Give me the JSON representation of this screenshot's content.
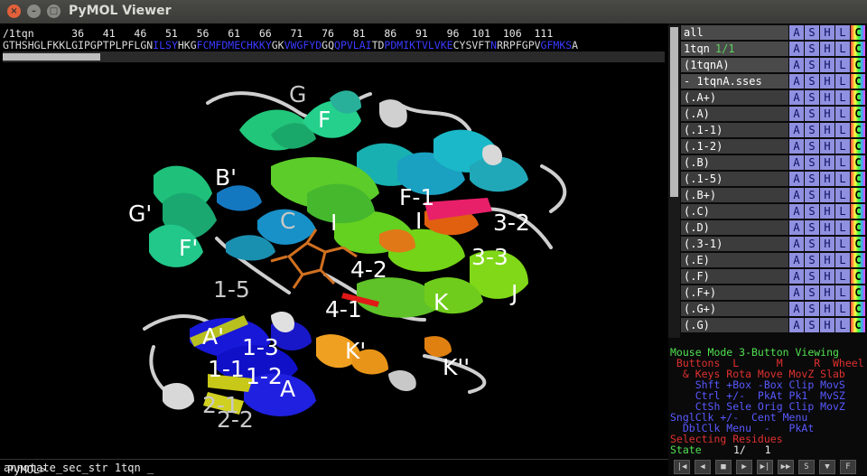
{
  "window": {
    "title": "PyMOL Viewer"
  },
  "sequence": {
    "ruler": "/1tqn      36   41   46   51   56   61   66   71   76   81   86   91   96  101  106  111",
    "residues": [
      {
        "text": "GTHSHGLFKKLGIPGPTPLPFLGN",
        "color": "#d8d8d8"
      },
      {
        "text": "ILSY",
        "color": "#3a3aff"
      },
      {
        "text": "HKG",
        "color": "#d8d8d8"
      },
      {
        "text": "FCMFDMECHKKY",
        "color": "#3a3aff"
      },
      {
        "text": "GK",
        "color": "#d8d8d8"
      },
      {
        "text": "VWGFYD",
        "color": "#3a3aff"
      },
      {
        "text": "GQ",
        "color": "#d8d8d8"
      },
      {
        "text": "QPVLAI",
        "color": "#3a3aff"
      },
      {
        "text": "TD",
        "color": "#d8d8d8"
      },
      {
        "text": "PDMIKTVLVKE",
        "color": "#3a3aff"
      },
      {
        "text": "CYSVFT",
        "color": "#d8d8d8"
      },
      {
        "text": "N",
        "color": "#3a3aff"
      },
      {
        "text": "RRPFGPV",
        "color": "#d8d8d8"
      },
      {
        "text": "GFMKS",
        "color": "#3a3aff"
      },
      {
        "text": "A",
        "color": "#d8d8d8"
      }
    ]
  },
  "viewer": {
    "labels": [
      {
        "text": "G",
        "grey": true
      },
      {
        "text": "F",
        "grey": false
      },
      {
        "text": "B'",
        "grey": false
      },
      {
        "text": "G'",
        "grey": false
      },
      {
        "text": "F-1",
        "grey": false
      },
      {
        "text": "C",
        "grey": true
      },
      {
        "text": "I",
        "grey": false
      },
      {
        "text": "I",
        "grey": false
      },
      {
        "text": "3-2",
        "grey": false
      },
      {
        "text": "3-3",
        "grey": false
      },
      {
        "text": "F'",
        "grey": false
      },
      {
        "text": "4-2",
        "grey": false
      },
      {
        "text": "1-5",
        "grey": true
      },
      {
        "text": "J",
        "grey": false
      },
      {
        "text": "4-1",
        "grey": false
      },
      {
        "text": "K",
        "grey": false
      },
      {
        "text": "A'",
        "grey": false
      },
      {
        "text": "1-3",
        "grey": false
      },
      {
        "text": "K'",
        "grey": false
      },
      {
        "text": "K''",
        "grey": false
      },
      {
        "text": "1-1",
        "grey": false
      },
      {
        "text": "1-2",
        "grey": false
      },
      {
        "text": "A",
        "grey": false
      },
      {
        "text": "2-1",
        "grey": true
      },
      {
        "text": "2-2",
        "grey": true
      }
    ]
  },
  "command": {
    "prompt": "PyMOL>",
    "text": "annotate_sec_str 1tqn _"
  },
  "objects": [
    {
      "name": "all",
      "suffix": "",
      "sub": false
    },
    {
      "name": "1tqn",
      "suffix": "1/1",
      "sub": false
    },
    {
      "name": "(1tqnA)",
      "suffix": "",
      "sub": false
    },
    {
      "name": "- 1tqnA.sses",
      "suffix": "",
      "sub": false
    },
    {
      "name": "(.A+)",
      "suffix": "",
      "sub": true
    },
    {
      "name": "(.A)",
      "suffix": "",
      "sub": true
    },
    {
      "name": "(.1-1)",
      "suffix": "",
      "sub": true
    },
    {
      "name": "(.1-2)",
      "suffix": "",
      "sub": true
    },
    {
      "name": "(.B)",
      "suffix": "",
      "sub": true
    },
    {
      "name": "(.1-5)",
      "suffix": "",
      "sub": true
    },
    {
      "name": "(.B+)",
      "suffix": "",
      "sub": true
    },
    {
      "name": "(.C)",
      "suffix": "",
      "sub": true
    },
    {
      "name": "(.D)",
      "suffix": "",
      "sub": true
    },
    {
      "name": "(.3-1)",
      "suffix": "",
      "sub": true
    },
    {
      "name": "(.E)",
      "suffix": "",
      "sub": true
    },
    {
      "name": "(.F)",
      "suffix": "",
      "sub": true
    },
    {
      "name": "(.F+)",
      "suffix": "",
      "sub": true
    },
    {
      "name": "(.G+)",
      "suffix": "",
      "sub": true
    },
    {
      "name": "(.G)",
      "suffix": "",
      "sub": true
    }
  ],
  "object_buttons": [
    "A",
    "S",
    "H",
    "L",
    "C"
  ],
  "mouse_info": {
    "header": "Mouse Mode 3-Button Viewing",
    "buttons_row": " Buttons  L      M     R  Wheel",
    "keys_row": "  & Keys Rota Move MovZ Slab",
    "shft_row": "    Shft +Box -Box Clip MovS",
    "ctrl_row": "    Ctrl +/-  PkAt Pk1  MvSZ",
    "ctsh_row": "    CtSh Sele Orig Clip MovZ",
    "sngl_row": "SnglClk +/-  Cent Menu",
    "dbl_row": "  DblClk Menu  -   PkAt",
    "selecting": "Selecting Residues",
    "state_label": "State",
    "state_value": "1/   1"
  },
  "transport_buttons": [
    "|◀",
    "◀",
    "■",
    "▶",
    "▶|",
    "▶▶",
    "S",
    "▼",
    "F"
  ]
}
